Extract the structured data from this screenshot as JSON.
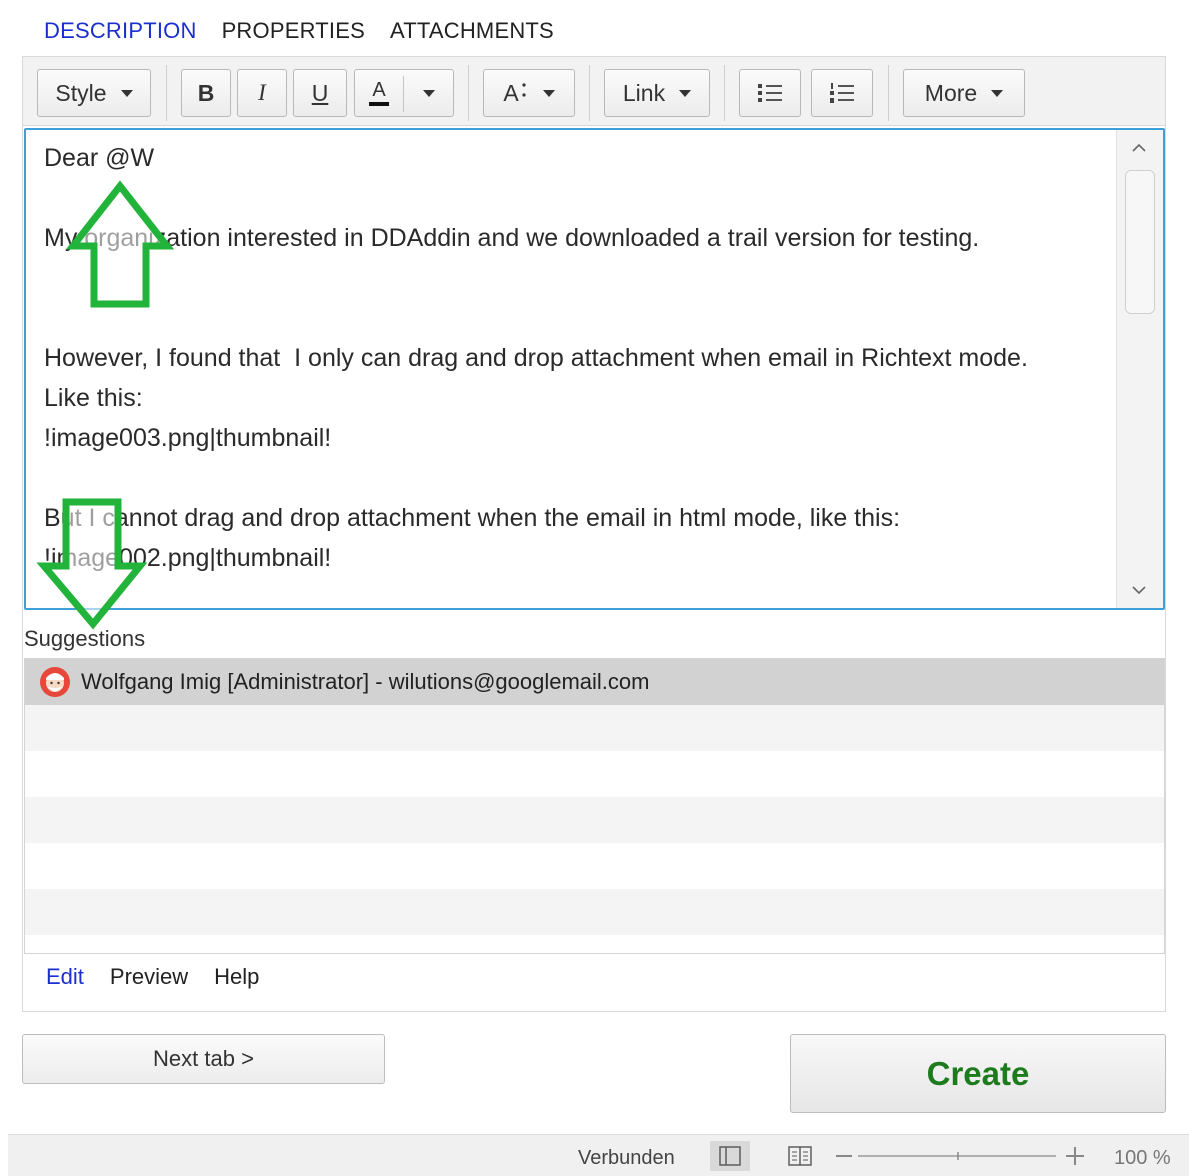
{
  "tabs": {
    "description": "DESCRIPTION",
    "properties": "PROPERTIES",
    "attachments": "ATTACHMENTS"
  },
  "toolbar": {
    "style_label": "Style",
    "bold_label": "B",
    "italic_label": "I",
    "underline_label": "U",
    "font_color_label": "A",
    "font_size_label": "A",
    "link_label": "Link",
    "more_label": "More"
  },
  "editor": {
    "text": "Dear @W\n\nMy organization interested in DDAddin and we downloaded a trail version for testing.\n\n\nHowever, I found that  I only can drag and drop attachment when email in Richtext mode.\nLike this:\n!image003.png|thumbnail!\n\nBut I cannot drag and drop attachment when the email in html mode, like this:\n!image002.png|thumbnail!"
  },
  "suggestions": {
    "label": "Suggestions",
    "items": [
      {
        "text": "Wolfgang Imig  [Administrator] - wilutions@googlemail.com"
      }
    ]
  },
  "bottom_tabs": {
    "edit": "Edit",
    "preview": "Preview",
    "help": "Help"
  },
  "buttons": {
    "next_tab": "Next tab >",
    "create": "Create"
  },
  "status": {
    "text": "Verbunden",
    "zoom": "100 %"
  },
  "colors": {
    "accent_blue": "#1b2fd0",
    "create_green": "#1d7a1d",
    "arrow_green": "#22b33a",
    "focus_border": "#3f9fd8"
  },
  "icons": [
    "caret-down-icon",
    "bullet-list-icon",
    "numbered-list-icon",
    "font-size-icon",
    "scroll-up-icon",
    "scroll-down-icon",
    "avatar-icon",
    "normal-view-icon",
    "reading-view-icon",
    "zoom-out-icon",
    "zoom-in-icon",
    "arrow-up-annotation",
    "arrow-down-annotation"
  ]
}
